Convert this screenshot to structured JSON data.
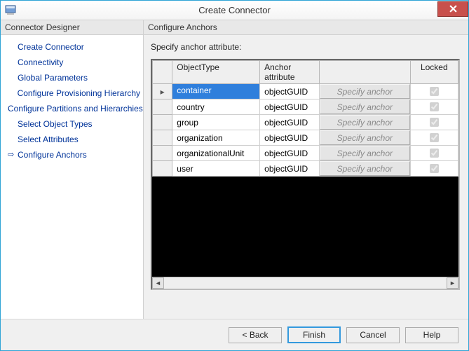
{
  "window": {
    "title": "Create Connector"
  },
  "leftHeader": "Connector Designer",
  "rightHeader": "Configure Anchors",
  "nav": [
    {
      "label": "Create Connector",
      "current": false
    },
    {
      "label": "Connectivity",
      "current": false
    },
    {
      "label": "Global Parameters",
      "current": false
    },
    {
      "label": "Configure Provisioning Hierarchy",
      "current": false
    },
    {
      "label": "Configure Partitions and Hierarchies",
      "current": false
    },
    {
      "label": "Select Object Types",
      "current": false
    },
    {
      "label": "Select Attributes",
      "current": false
    },
    {
      "label": "Configure Anchors",
      "current": true
    }
  ],
  "instruction": "Specify anchor attribute:",
  "columns": {
    "objectType": "ObjectType",
    "anchorAttr": "Anchor attribute",
    "action": "",
    "locked": "Locked"
  },
  "actionLabel": "Specify anchor",
  "rows": [
    {
      "objectType": "container",
      "anchor": "objectGUID",
      "locked": true,
      "selected": true,
      "pointer": true
    },
    {
      "objectType": "country",
      "anchor": "objectGUID",
      "locked": true,
      "selected": false,
      "pointer": false
    },
    {
      "objectType": "group",
      "anchor": "objectGUID",
      "locked": true,
      "selected": false,
      "pointer": false
    },
    {
      "objectType": "organization",
      "anchor": "objectGUID",
      "locked": true,
      "selected": false,
      "pointer": false
    },
    {
      "objectType": "organizationalUnit",
      "anchor": "objectGUID",
      "locked": true,
      "selected": false,
      "pointer": false
    },
    {
      "objectType": "user",
      "anchor": "objectGUID",
      "locked": true,
      "selected": false,
      "pointer": false
    }
  ],
  "buttons": {
    "back": "<  Back",
    "finish": "Finish",
    "cancel": "Cancel",
    "help": "Help"
  }
}
